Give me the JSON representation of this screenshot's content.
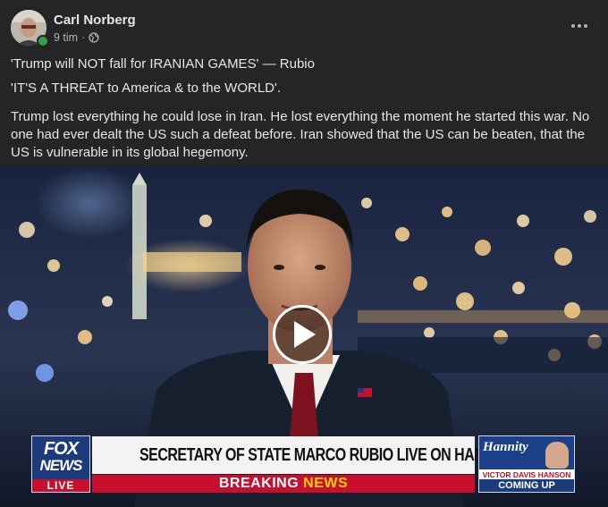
{
  "post": {
    "author": "Carl Norberg",
    "time": "9 tim",
    "separator": "·",
    "audience_icon": "globe-icon",
    "more_icon": "more-options-icon",
    "lines": [
      "'Trump will NOT fall for IRANIAN GAMES' — Rubio",
      "'IT'S A THREAT to America & to the WORLD'."
    ],
    "paragraph": "Trump lost everything he could lose in Iran. He lost everything the moment he started this war. No one had ever dealt the US such a defeat before. Iran showed that the US can be beaten, that the US is vulnerable in its global hegemony."
  },
  "video": {
    "play_icon": "play-icon",
    "chyron": {
      "logo_top": "FOX",
      "logo_mid": "NEWS",
      "logo_live": "LIVE",
      "headline": "SECRETARY OF STATE MARCO RUBIO LIVE ON HANNITY",
      "breaking_1": "BREAKING",
      "breaking_2": "NEWS",
      "promo_show": "Hannity",
      "promo_guest": "VICTOR DAVIS HANSON",
      "promo_coming": "COMING UP"
    }
  },
  "colors": {
    "background": "#242526",
    "text": "#e4e6eb",
    "secondary_text": "#b0b3b8",
    "online": "#31a24c",
    "fox_red": "#c8102e",
    "fox_blue": "#1b3b7c"
  }
}
